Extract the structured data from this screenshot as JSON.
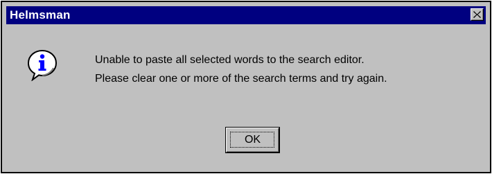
{
  "window": {
    "title": "Helmsman",
    "close_icon": "close-icon"
  },
  "dialog": {
    "icon": "info-icon",
    "message_lines": [
      "Unable to paste all selected words to the search editor.",
      "Please clear one or more of the search terms and try again."
    ],
    "ok_label": "OK"
  },
  "colors": {
    "titlebar": "#000080",
    "face": "#c0c0c0",
    "icon_blue": "#0000ff"
  }
}
